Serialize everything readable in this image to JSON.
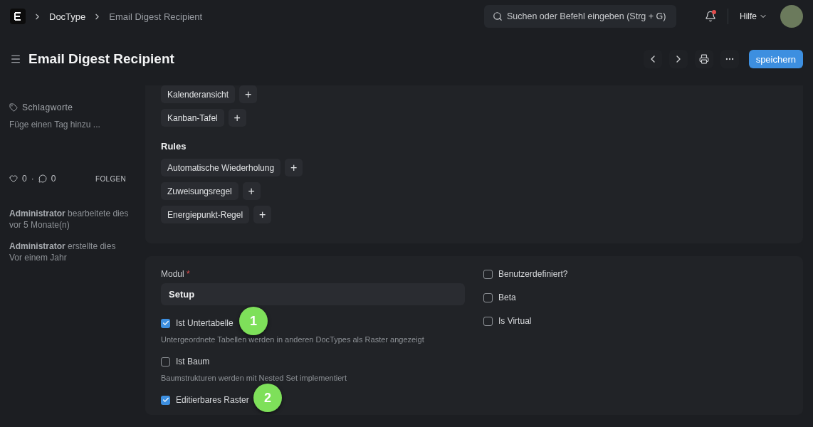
{
  "navbar": {
    "breadcrumbs": [
      {
        "label": "DocType",
        "current": false
      },
      {
        "label": "Email Digest Recipient",
        "current": true
      }
    ],
    "search": {
      "placeholder": "Suchen oder Befehl eingeben (Strg + G)"
    },
    "notification_unread": true,
    "help": "Hilfe"
  },
  "page_header": {
    "title": "Email Digest Recipient",
    "save_button": "speichern"
  },
  "sidebar": {
    "tags_label": "Schlagworte",
    "add_tag": "Füge einen Tag hinzu ...",
    "likes": "0",
    "separator": "·",
    "comments": "0",
    "follow": "FOLGEN",
    "activity": [
      {
        "user": "Administrator",
        "action": "bearbeitete dies",
        "time": "vor 5 Monate(n)"
      },
      {
        "user": "Administrator",
        "action": "erstellte dies",
        "time": "Vor einem Jahr"
      }
    ]
  },
  "views": [
    {
      "label": "Kalenderansicht",
      "add": "+"
    },
    {
      "label": "Kanban-Tafel",
      "add": "+"
    }
  ],
  "rules": {
    "title": "Rules",
    "items": [
      {
        "label": "Automatische Wiederholung",
        "add": "+"
      },
      {
        "label": "Zuweisungsregel",
        "add": "+"
      },
      {
        "label": "Energiepunkt-Regel",
        "add": "+"
      }
    ]
  },
  "settings": {
    "module": {
      "label": "Modul",
      "required_mark": "*",
      "value": "Setup"
    },
    "left_checks": [
      {
        "label": "Ist Untertabelle",
        "checked": true,
        "description": "Untergeordnete Tabellen werden in anderen DocTypes als Raster angezeigt",
        "badge": "1"
      },
      {
        "label": "Ist Baum",
        "checked": false,
        "description": "Baumstrukturen werden mit Nested Set implementiert"
      },
      {
        "label": "Editierbares Raster",
        "checked": true,
        "badge": "2"
      }
    ],
    "right_checks": [
      {
        "label": "Benutzerdefiniert?",
        "checked": false
      },
      {
        "label": "Beta",
        "checked": false
      },
      {
        "label": "Is Virtual",
        "checked": false
      }
    ]
  }
}
